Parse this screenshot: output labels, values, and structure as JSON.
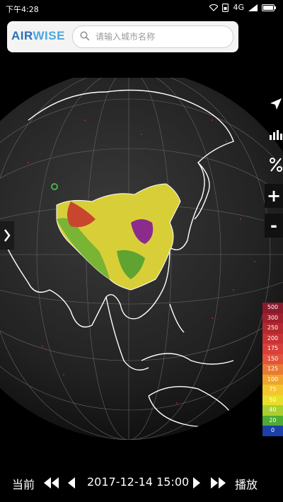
{
  "status": {
    "time": "下午4:28",
    "network": "4G"
  },
  "brand": {
    "part1": "AIR",
    "part2": "WISE"
  },
  "search": {
    "placeholder": "请输入城市名称"
  },
  "side_controls": {
    "zoom_in": "+",
    "zoom_out": "-"
  },
  "legend": [
    {
      "value": "500",
      "color": "#8b1a2c"
    },
    {
      "value": "300",
      "color": "#a0202e"
    },
    {
      "value": "250",
      "color": "#b42a30"
    },
    {
      "value": "200",
      "color": "#c83335"
    },
    {
      "value": "175",
      "color": "#d9403a"
    },
    {
      "value": "150",
      "color": "#e4533c"
    },
    {
      "value": "125",
      "color": "#e97a33"
    },
    {
      "value": "100",
      "color": "#f0a42c"
    },
    {
      "value": "75",
      "color": "#f4c62b"
    },
    {
      "value": "50",
      "color": "#e8de2c"
    },
    {
      "value": "40",
      "color": "#a9cf2e"
    },
    {
      "value": "20",
      "color": "#4faa33"
    },
    {
      "value": "0",
      "color": "#1c3fa8"
    }
  ],
  "bottom": {
    "current_label": "当前",
    "datetime": "2017-12-14 15:00",
    "play_label": "播放"
  }
}
